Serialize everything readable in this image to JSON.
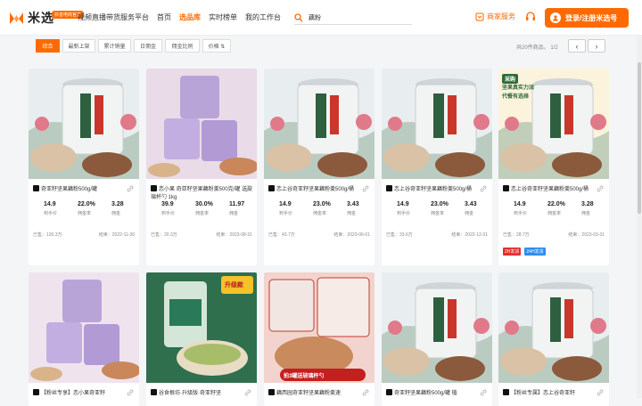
{
  "header": {
    "logo_text": "米选",
    "logo_badge": "抖音电商官方",
    "platform_name": "视频直播带货服务平台",
    "nav": [
      "首页",
      "选品库",
      "实时榜单",
      "我的工作台"
    ],
    "nav_active": 1,
    "search_value": "藕粉",
    "merchant_label": "商家服务",
    "login_label": "登录/注册米选号"
  },
  "toolbar": {
    "sort_tabs": [
      "综合",
      "最新上架",
      "累计销量",
      "日佣金",
      "佣金比例",
      "价格 ⇅"
    ],
    "active_tab": 0,
    "count_text": "共20件商品，  1/2",
    "prev_label": "‹",
    "next_label": "›"
  },
  "stat_labels": [
    "到手价",
    "佣金率",
    "佣金"
  ],
  "colors": {
    "accent": "#ff6a00",
    "tag_red": "#e52d2d",
    "tag_blue": "#2f8cf0"
  },
  "products": [
    {
      "title": "奇亚籽坚果藕粉500g/罐",
      "price": "14.9",
      "rate": "22.0%",
      "commission": "3.28",
      "sold": "已售：126.3万",
      "end": "结束：2022-11-30",
      "img": "jar"
    },
    {
      "title": "恋小果 奇亚籽坚果藕粉羹500克/罐 送玻璃杯勺 1kg",
      "price": "39.9",
      "rate": "30.0%",
      "commission": "11.97",
      "sold": "已售：20.3万",
      "end": "结束：2023-08-31",
      "img": "purple"
    },
    {
      "title": "恋上谷奇亚籽坚果藕粉羹500g/桶",
      "price": "14.9",
      "rate": "23.0%",
      "commission": "3.43",
      "sold": "已售：43.7万",
      "end": "结束：2023-06-01",
      "img": "jar"
    },
    {
      "title": "恋上谷奇亚籽坚果藕粉羹500g/桶",
      "price": "14.9",
      "rate": "23.0%",
      "commission": "3.43",
      "sold": "已售：33.6万",
      "end": "结束：2022-12-31",
      "img": "jar"
    },
    {
      "title": "恋上谷奇亚籽坚果藕粉羹500g/桶",
      "price": "14.9",
      "rate": "22.0%",
      "commission": "3.28",
      "sold": "已售：28.7万",
      "end": "结束：2023-03-31",
      "img": "promo",
      "badges": [
        "2H发货",
        "24H发货"
      ],
      "promo_lines": [
        "采购",
        "坚果真实力派",
        "代餐有选择"
      ]
    },
    {
      "title": "【粉丝专享】恋小果奇亚籽",
      "img": "purple2"
    },
    {
      "title": "谷食根坊·升级版·奇亚籽坚",
      "img": "green",
      "promo_lines": [
        "升级款"
      ]
    },
    {
      "title": "藕西园奇亚籽坚果藕粉羹速",
      "img": "red",
      "promo_lines": [
        "拍3罐送玻璃杯勺"
      ]
    },
    {
      "title": "奇亚籽坚果藕粉500g/罐 植",
      "img": "jar"
    },
    {
      "title": "【粉丝专属】恋上谷奇亚籽",
      "img": "jar"
    }
  ]
}
